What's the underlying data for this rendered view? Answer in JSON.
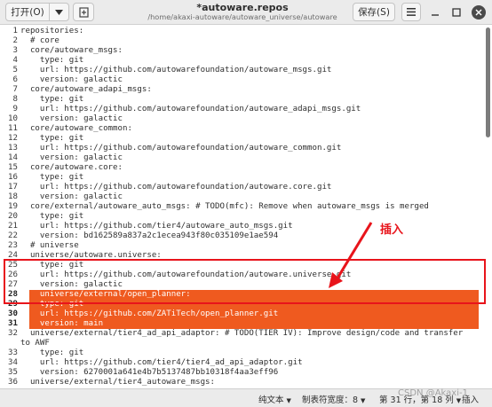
{
  "header": {
    "open_label": "打开(O)",
    "open_arrow_icon": "chevron-down",
    "new_tab_icon": "new-document",
    "title": "*autoware.repos",
    "path": "/home/akaxi-autoware/autoware_universe/autoware",
    "save_label": "保存(S)",
    "menu_icon": "hamburger-menu",
    "minimize_icon": "minimize",
    "maximize_icon": "maximize",
    "close_icon": "close"
  },
  "editor": {
    "lines": [
      {
        "n": "1",
        "text": "repositories:"
      },
      {
        "n": "2",
        "text": "  # core"
      },
      {
        "n": "3",
        "text": "  core/autoware_msgs:"
      },
      {
        "n": "4",
        "text": "    type: git"
      },
      {
        "n": "5",
        "text": "    url: https://github.com/autowarefoundation/autoware_msgs.git"
      },
      {
        "n": "6",
        "text": "    version: galactic"
      },
      {
        "n": "7",
        "text": "  core/autoware_adapi_msgs:"
      },
      {
        "n": "8",
        "text": "    type: git"
      },
      {
        "n": "9",
        "text": "    url: https://github.com/autowarefoundation/autoware_adapi_msgs.git"
      },
      {
        "n": "10",
        "text": "    version: galactic"
      },
      {
        "n": "11",
        "text": "  core/autoware_common:"
      },
      {
        "n": "12",
        "text": "    type: git"
      },
      {
        "n": "13",
        "text": "    url: https://github.com/autowarefoundation/autoware_common.git"
      },
      {
        "n": "14",
        "text": "    version: galactic"
      },
      {
        "n": "15",
        "text": "  core/autoware.core:"
      },
      {
        "n": "16",
        "text": "    type: git"
      },
      {
        "n": "17",
        "text": "    url: https://github.com/autowarefoundation/autoware.core.git"
      },
      {
        "n": "18",
        "text": "    version: galactic"
      },
      {
        "n": "19",
        "text": "  core/external/autoware_auto_msgs: # TODO(mfc): Remove when autoware_msgs is merged"
      },
      {
        "n": "20",
        "text": "    type: git"
      },
      {
        "n": "21",
        "text": "    url: https://github.com/tier4/autoware_auto_msgs.git"
      },
      {
        "n": "22",
        "text": "    version: bd162589a837a2c1ecea943f80c035109e1ae594"
      },
      {
        "n": "23",
        "text": "  # universe"
      },
      {
        "n": "24",
        "text": "  universe/autoware.universe:"
      },
      {
        "n": "25",
        "text": "    type: git"
      },
      {
        "n": "26",
        "text": "    url: https://github.com/autowarefoundation/autoware.universe.git"
      },
      {
        "n": "27",
        "text": "    version: galactic"
      },
      {
        "n": "28",
        "text": "    universe/external/open_planner:"
      },
      {
        "n": "29",
        "text": "    type: git"
      },
      {
        "n": "30",
        "text": "    url: https://github.com/ZATiTech/open_planner.git"
      },
      {
        "n": "31",
        "text": "    version: main"
      },
      {
        "n": "32",
        "text": "  universe/external/tier4_ad_api_adaptor: # TODO(TIER IV): Improve design/code and transfer",
        "wrap": "to AWF"
      },
      {
        "n": "33",
        "text": "    type: git"
      },
      {
        "n": "34",
        "text": "    url: https://github.com/tier4/tier4_ad_api_adaptor.git"
      },
      {
        "n": "35",
        "text": "    version: 6270001a641e4b7b5137487bb10318f4aa3eff96"
      },
      {
        "n": "36",
        "text": "  universe/external/tier4_autoware_msgs:"
      }
    ],
    "selected_lines": [
      "28",
      "29",
      "30",
      "31"
    ],
    "highlight_color": "#ef5a1f"
  },
  "annotation": {
    "label": "插入",
    "color": "#e8141b"
  },
  "statusbar": {
    "language": "纯文本",
    "tab_width": "制表符宽度：8",
    "position": "第 31 行，第 18 列",
    "mode": "插入"
  },
  "watermark": "CSDN @Akaxi-1"
}
